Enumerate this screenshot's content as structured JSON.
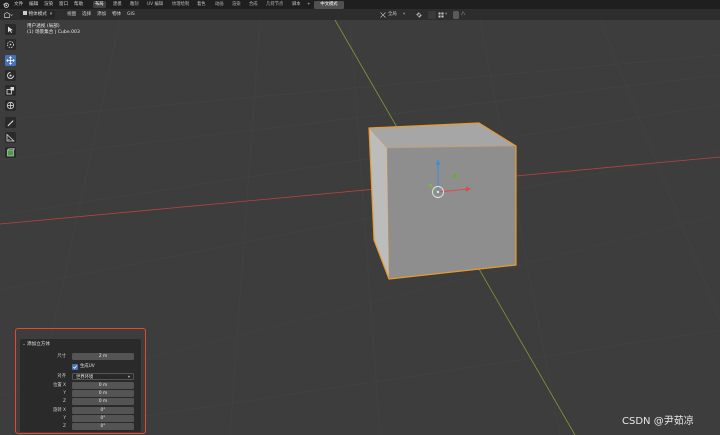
{
  "menu": {
    "items": [
      "文件",
      "编辑",
      "渲染",
      "窗口",
      "帮助"
    ]
  },
  "workspaces": {
    "tabs": [
      "布局",
      "建模",
      "雕刻",
      "UV 编辑",
      "纹理绘制",
      "着色",
      "动画",
      "渲染",
      "合成",
      "几何节点",
      "脚本"
    ],
    "active": "布局",
    "special": "中文模式",
    "add": "+"
  },
  "header": {
    "mode": "物体模式",
    "menus": [
      "视图",
      "选择",
      "添加",
      "物体",
      "GIS"
    ],
    "orientation": "全局",
    "right_extra": "八"
  },
  "viewport": {
    "view_name": "用户透视 (局部)",
    "collection": "(1) 场景集合 | Cube.003"
  },
  "panel": {
    "title": "添加立方体",
    "size_label": "尺寸",
    "size_value": "2 m",
    "uv_label": "生成UV",
    "align_label": "对齐",
    "align_value": "世界环境",
    "location_label": "位置 X",
    "location": [
      "0 m",
      "0 m",
      "0 m"
    ],
    "rotation_label": "旋转 X",
    "rotation": [
      "0°",
      "0°",
      "0°"
    ],
    "y_label": "Y",
    "z_label": "Z"
  },
  "watermark": "CSDN @尹茹凉",
  "colors": {
    "accent": "#4772b3",
    "selection_outline": "#e89a2c",
    "x_axis": "#b8433f",
    "y_axis": "#8aa63a",
    "highlight_box": "#e04a2c"
  }
}
